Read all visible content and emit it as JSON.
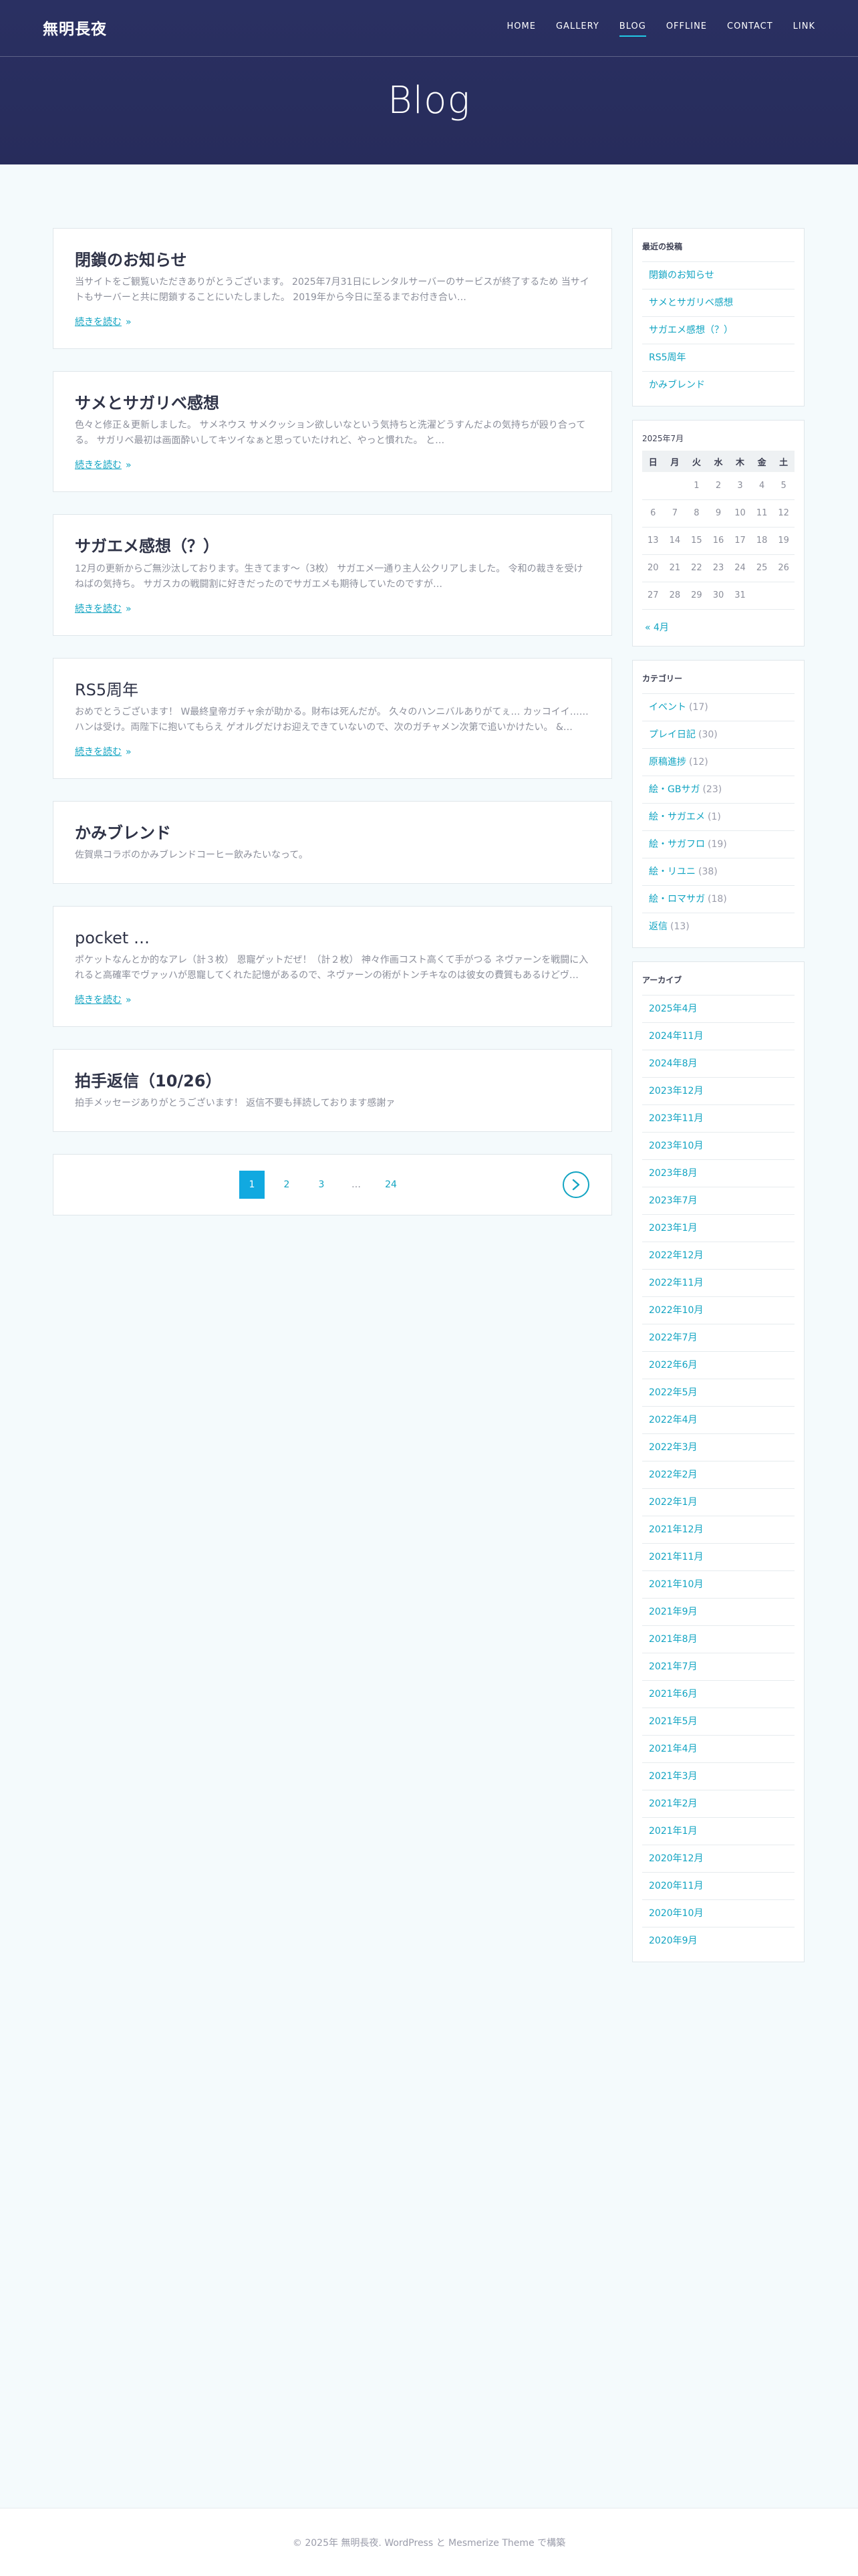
{
  "header": {
    "brand": "無明長夜",
    "nav": [
      "HOME",
      "GALLERY",
      "BLOG",
      "OFFLINE",
      "CONTACT",
      "LINK"
    ],
    "active_nav": "BLOG",
    "hero_title": "Blog"
  },
  "colors": {
    "header_bg": "#272c5b",
    "accent": "#12a4c2",
    "page_bg": "#f4fafc"
  },
  "posts": [
    {
      "title": "閉鎖のお知らせ",
      "excerpt": "当サイトをご観覧いただきありがとうございます。 2025年7月31日にレンタルサーバーのサービスが終了するため 当サイトもサーバーと共に閉鎖することにいたしました。 2019年から今日に至るまでお付き合い…",
      "more": "続きを読む"
    },
    {
      "title": "サメとサガリベ感想",
      "excerpt": "色々と修正＆更新しました。 サメネウス サメクッション欲しいなという気持ちと洗濯どうすんだよの気持ちが殴り合ってる。 サガリベ最初は画面酔いしてキツイなぁと思っていたけれど、やっと慣れた。 と…",
      "more": "続きを読む"
    },
    {
      "title": "サガエメ感想（？）",
      "excerpt": "12月の更新からご無沙汰しております。生きてます〜（3枚） サガエメ一通り主人公クリアしました。 令和の裁きを受けねばの気持ち。 サガスカの戦闘割に好きだったのでサガエメも期待していたのですが…",
      "more": "続きを読む"
    },
    {
      "title": "RS5周年",
      "excerpt": "おめでとうございます！ W最終皇帝ガチャ余が助かる。財布は死んだが。 久々のハンニバルありがてぇ… カッコイイ……ハンは受け。両陛下に抱いてもらえ ゲオルグだけお迎えできていないので、次のガチャメン次第で追いかけたい。 &…",
      "more": "続きを読む"
    },
    {
      "title": "かみブレンド",
      "excerpt": "佐賀県コラボのかみブレンドコーヒー飲みたいなって。",
      "more": ""
    },
    {
      "title": "pocket …",
      "excerpt": "ポケットなんとか的なアレ（計３枚） 恩寵ゲットだぜ！（計２枚） 神々作画コスト高くて手がつる ネヴァーンを戦闘に入れると高確率でヴァッハが恩寵してくれた記憶があるので、ネヴァーンの術がトンチキなのは彼女の費質もあるけどヴ…",
      "more": "続きを読む"
    },
    {
      "title": "拍手返信（10/26）",
      "excerpt": "拍手メッセージありがとうございます！ 返信不要も拝読しております感謝ァ",
      "more": ""
    }
  ],
  "pagination": {
    "pages": [
      "1",
      "2",
      "3",
      "…",
      "24"
    ],
    "current": "1"
  },
  "sidebar": {
    "recent": {
      "title": "最近の投稿",
      "items": [
        "閉鎖のお知らせ",
        "サメとサガリベ感想",
        "サガエメ感想（？）",
        "RS5周年",
        "かみブレンド"
      ]
    },
    "calendar": {
      "caption": "2025年7月",
      "weekdays": [
        "日",
        "月",
        "火",
        "水",
        "木",
        "金",
        "土"
      ],
      "weeks": [
        [
          "",
          "",
          "1",
          "2",
          "3",
          "4",
          "5"
        ],
        [
          "6",
          "7",
          "8",
          "9",
          "10",
          "11",
          "12"
        ],
        [
          "13",
          "14",
          "15",
          "16",
          "17",
          "18",
          "19"
        ],
        [
          "20",
          "21",
          "22",
          "23",
          "24",
          "25",
          "26"
        ],
        [
          "27",
          "28",
          "29",
          "30",
          "31",
          "",
          ""
        ]
      ],
      "prev": "« 4月"
    },
    "categories": {
      "title": "カテゴリー",
      "items": [
        {
          "name": "イベント",
          "count": "(17)"
        },
        {
          "name": "プレイ日記",
          "count": "(30)"
        },
        {
          "name": "原稿進捗",
          "count": "(12)"
        },
        {
          "name": "絵・GBサガ",
          "count": "(23)"
        },
        {
          "name": "絵・サガエメ",
          "count": "(1)"
        },
        {
          "name": "絵・サガフロ",
          "count": "(19)"
        },
        {
          "name": "絵・リユニ",
          "count": "(38)"
        },
        {
          "name": "絵・ロマサガ",
          "count": "(18)"
        },
        {
          "name": "返信",
          "count": "(13)"
        }
      ]
    },
    "archive": {
      "title": "アーカイブ",
      "items": [
        "2025年4月",
        "2024年11月",
        "2024年8月",
        "2023年12月",
        "2023年11月",
        "2023年10月",
        "2023年8月",
        "2023年7月",
        "2023年1月",
        "2022年12月",
        "2022年11月",
        "2022年10月",
        "2022年7月",
        "2022年6月",
        "2022年5月",
        "2022年4月",
        "2022年3月",
        "2022年2月",
        "2022年1月",
        "2021年12月",
        "2021年11月",
        "2021年10月",
        "2021年9月",
        "2021年8月",
        "2021年7月",
        "2021年6月",
        "2021年5月",
        "2021年4月",
        "2021年3月",
        "2021年2月",
        "2021年1月",
        "2020年12月",
        "2020年11月",
        "2020年10月",
        "2020年9月"
      ]
    }
  },
  "footer": {
    "text": "© 2025年 無明長夜. WordPress と Mesmerize Theme で構築"
  }
}
